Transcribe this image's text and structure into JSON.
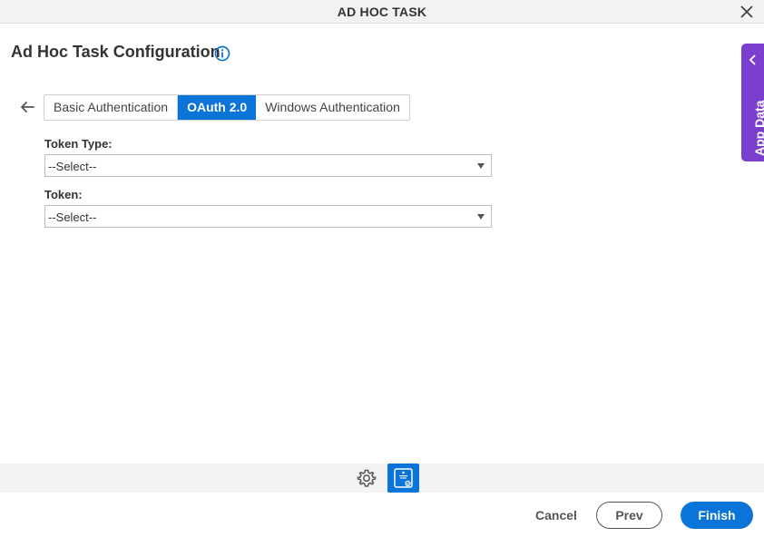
{
  "window": {
    "title": "AD HOC TASK"
  },
  "page": {
    "heading": "Ad Hoc Task Configuration"
  },
  "tabs": [
    {
      "label": "Basic Authentication",
      "active": false
    },
    {
      "label": "OAuth 2.0",
      "active": true
    },
    {
      "label": "Windows Authentication",
      "active": false
    }
  ],
  "fields": {
    "token_type": {
      "label": "Token Type:",
      "value": "--Select--"
    },
    "token": {
      "label": "Token:",
      "value": "--Select--"
    }
  },
  "side_panel": {
    "label": "App Data"
  },
  "footer": {
    "cancel": "Cancel",
    "prev": "Prev",
    "finish": "Finish"
  },
  "colors": {
    "primary": "#0b74d8",
    "side_panel": "#7b3fcf",
    "toolbar_bg": "#f2f3f5"
  },
  "icons": [
    "close-icon",
    "info-icon",
    "back-arrow-icon",
    "chevron-left-icon",
    "gear-icon",
    "workflow-designer-icon",
    "dropdown-caret-icon"
  ]
}
